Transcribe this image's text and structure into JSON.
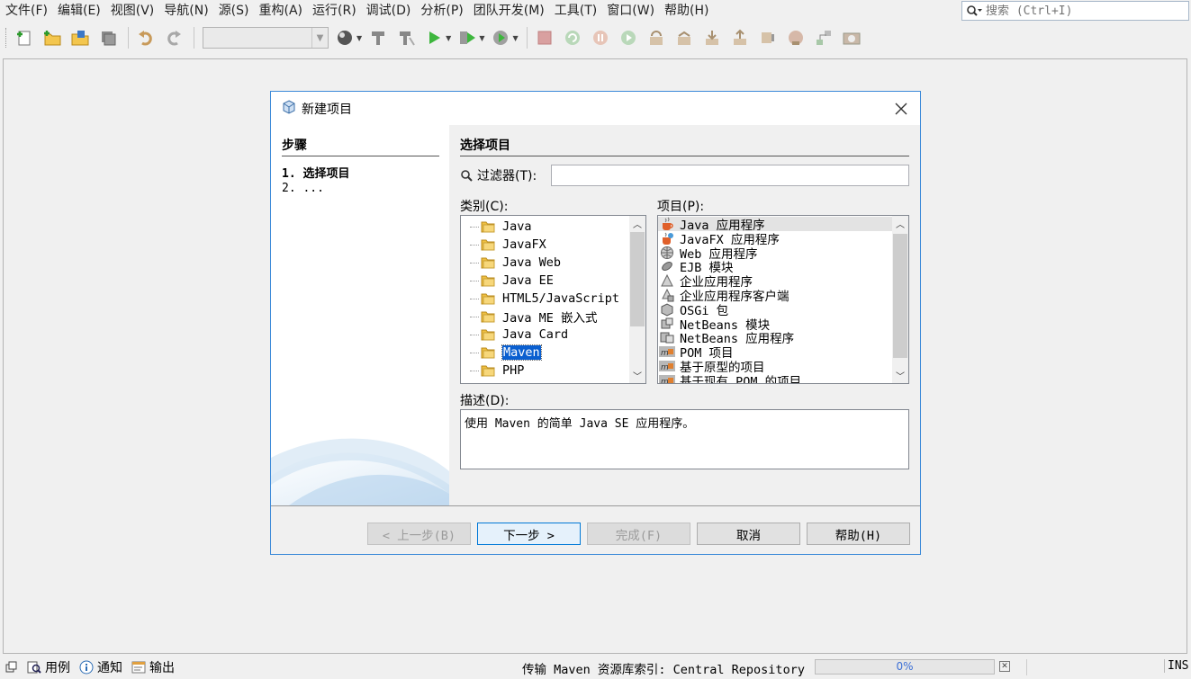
{
  "menu": [
    "文件(F)",
    "编辑(E)",
    "视图(V)",
    "导航(N)",
    "源(S)",
    "重构(A)",
    "运行(R)",
    "调试(D)",
    "分析(P)",
    "团队开发(M)",
    "工具(T)",
    "窗口(W)",
    "帮助(H)"
  ],
  "search": {
    "placeholder": "搜索 (Ctrl+I)"
  },
  "dialog": {
    "title": "新建项目",
    "steps_title": "步骤",
    "steps": [
      "1.  选择项目",
      "2.  ..."
    ],
    "content_title": "选择项目",
    "filter_label": "过滤器(T):",
    "filter_value": "",
    "categories_label": "类别(C):",
    "projects_label": "项目(P):",
    "categories": [
      "Java",
      "JavaFX",
      "Java Web",
      "Java EE",
      "HTML5/JavaScript",
      "Java ME 嵌入式",
      "Java Card",
      "Maven",
      "PHP"
    ],
    "selected_category": "Maven",
    "projects": [
      "Java 应用程序",
      "JavaFX 应用程序",
      "Web 应用程序",
      "EJB 模块",
      "企业应用程序",
      "企业应用程序客户端",
      "OSGi 包",
      "NetBeans 模块",
      "NetBeans 应用程序",
      "POM 项目",
      "基于原型的项目",
      "基于现有 POM 的项目"
    ],
    "selected_project": "Java 应用程序",
    "description_label": "描述(D):",
    "description": "使用 Maven 的简单 Java SE 应用程序。",
    "buttons": {
      "back": "< 上一步(B)",
      "next": "下一步 >",
      "finish": "完成(F)",
      "cancel": "取消",
      "help": "帮助(H)"
    }
  },
  "statusbar": {
    "usages": "用例",
    "notifications": "通知",
    "output": "输出",
    "status_text": "传输 Maven 资源库索引: Central Repository",
    "progress_percent": 0,
    "progress_label": "0%",
    "mode": "INS"
  },
  "colors": {
    "accent": "#3c8ad9",
    "selection": "#0a5fd0",
    "folder": "#f0c040"
  }
}
